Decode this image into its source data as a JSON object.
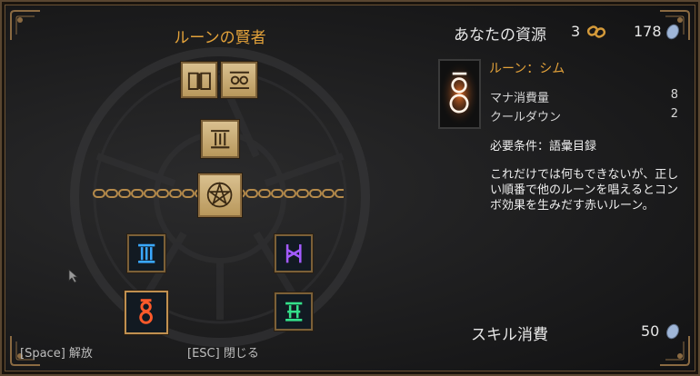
{
  "panel": {
    "title": "ルーンの賢者"
  },
  "resources": {
    "label": "あなたの資源",
    "link_count": "3",
    "coins": "178",
    "link_icon": "chain-link-icon",
    "coin_icon": "silver-coin-icon"
  },
  "rune": {
    "name": "ルーン：シム",
    "stats": [
      {
        "label": "マナ消費量",
        "value": "8"
      },
      {
        "label": "クールダウン",
        "value": "2"
      }
    ],
    "requirement": "必要条件：語彙目録",
    "description": "これだけでは何もできないが、正しい順番で他のルーンを唱えるとコンボ効果を生みだす赤いルーン。"
  },
  "skill": {
    "label": "スキル消費",
    "value": "50"
  },
  "hints": {
    "space": "[Space] 解放",
    "esc": "[ESC] 閉じる"
  },
  "colors": {
    "accent": "#e3a23a",
    "rune_blue": "#3aa8ff",
    "rune_purple": "#a35bff",
    "rune_red": "#ff5a2a",
    "rune_green": "#34e08a"
  }
}
